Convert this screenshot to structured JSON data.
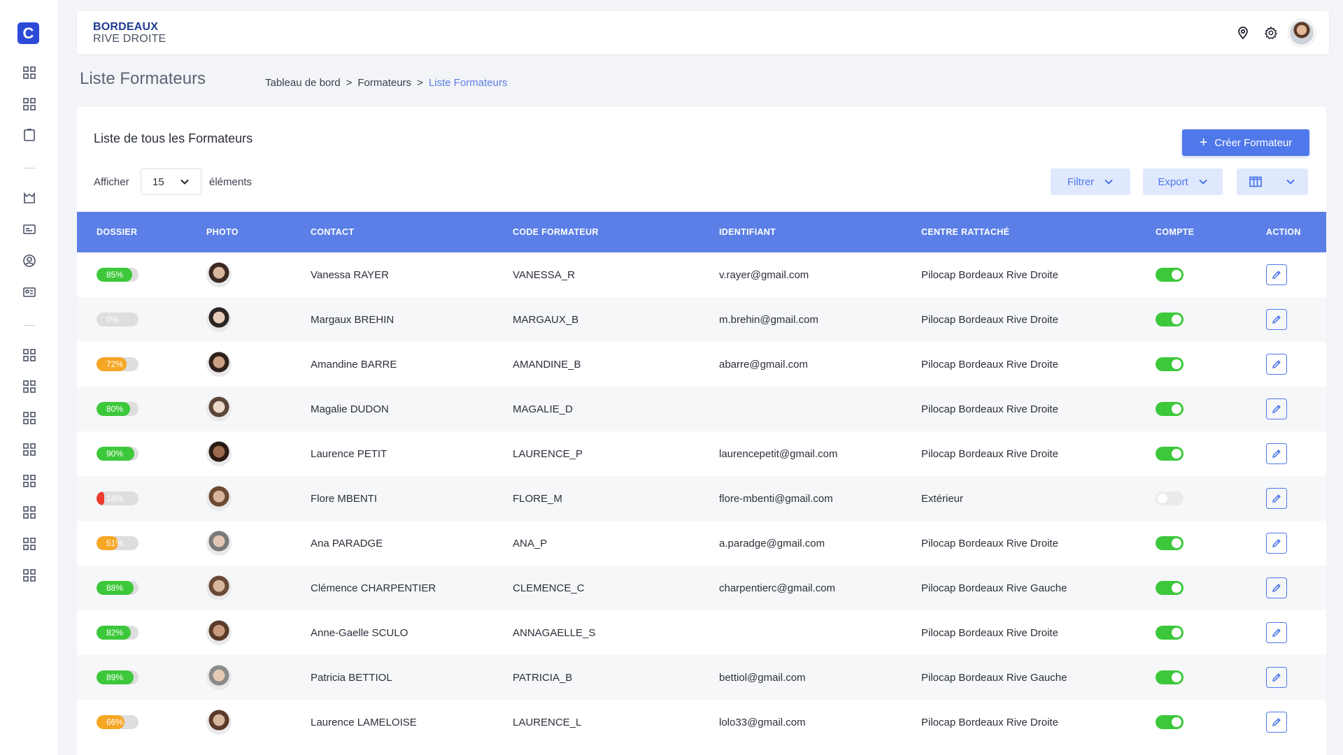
{
  "app": {
    "logo_letter": "C",
    "accent": "#4f78ea",
    "header_blue": "#5b7fe6"
  },
  "topbar": {
    "brand_line1": "BORDEAUX",
    "brand_line2": "RIVE DROITE",
    "icons": [
      "location-pin-icon",
      "gear-icon",
      "user-avatar"
    ]
  },
  "sidebar": {
    "icons": [
      "grid-icon",
      "grid-icon",
      "clipboard-icon",
      "inbox-icon",
      "id-card-icon",
      "user-circle-icon",
      "contact-card-icon",
      "grid-icon",
      "grid-icon",
      "grid-icon",
      "grid-icon",
      "grid-icon",
      "grid-icon",
      "grid-icon",
      "grid-icon"
    ]
  },
  "page": {
    "title": "Liste Formateurs",
    "breadcrumb": [
      "Tableau de bord",
      "Formateurs",
      "Liste Formateurs"
    ],
    "breadcrumb_sep": ">"
  },
  "card": {
    "title": "Liste de tous les Formateurs",
    "create_label": "Créer Formateur",
    "show_label": "Afficher",
    "page_size": "15",
    "elements_label": "éléments",
    "filter_label": "Filtrer",
    "export_label": "Export"
  },
  "table": {
    "headers": [
      "DOSSIER",
      "PHOTO",
      "CONTACT",
      "CODE FORMATEUR",
      "IDENTIFIANT",
      "CENTRE RATTACHÉ",
      "COMPTE",
      "ACTION"
    ],
    "rows": [
      {
        "dossier": "85%",
        "pct": 0.85,
        "color": "#3cc83a",
        "contact": "Vanessa RAYER",
        "code": "VANESSA_R",
        "identifiant": "v.rayer@gmail.com",
        "centre": "Pilocap Bordeaux Rive Droite",
        "compte": true
      },
      {
        "dossier": "0%",
        "pct": 0.0,
        "color": "#3cc83a",
        "contact": "Margaux BREHIN",
        "code": "MARGAUX_B",
        "identifiant": "m.brehin@gmail.com",
        "centre": "Pilocap Bordeaux Rive Droite",
        "compte": true
      },
      {
        "dossier": "72%",
        "pct": 0.72,
        "color": "#f5a623",
        "contact": "Amandine BARRE",
        "code": "AMANDINE_B",
        "identifiant": "abarre@gmail.com",
        "centre": "Pilocap Bordeaux Rive Droite",
        "compte": true
      },
      {
        "dossier": "80%",
        "pct": 0.8,
        "color": "#3cc83a",
        "contact": "Magalie DUDON",
        "code": "MAGALIE_D",
        "identifiant": "",
        "centre": "Pilocap Bordeaux Rive Droite",
        "compte": true
      },
      {
        "dossier": "90%",
        "pct": 0.9,
        "color": "#3cc83a",
        "contact": "Laurence PETIT",
        "code": "LAURENCE_P",
        "identifiant": "laurencepetit@gmail.com",
        "centre": "Pilocap Bordeaux Rive Droite",
        "compte": true
      },
      {
        "dossier": "18%",
        "pct": 0.18,
        "color": "#ee3b2c",
        "contact": "Flore MBENTI",
        "code": "FLORE_M",
        "identifiant": "flore-mbenti@gmail.com",
        "centre": "Extérieur",
        "compte": false
      },
      {
        "dossier": "51%",
        "pct": 0.51,
        "color": "#f5a623",
        "contact": "Ana PARADGE",
        "code": "ANA_P",
        "identifiant": "a.paradge@gmail.com",
        "centre": "Pilocap Bordeaux Rive Droite",
        "compte": true
      },
      {
        "dossier": "88%",
        "pct": 0.88,
        "color": "#3cc83a",
        "contact": "Clémence CHARPENTIER",
        "code": "CLEMENCE_C",
        "identifiant": "charpentierc@gmail.com",
        "centre": "Pilocap Bordeaux Rive Gauche",
        "compte": true
      },
      {
        "dossier": "82%",
        "pct": 0.82,
        "color": "#3cc83a",
        "contact": "Anne-Gaelle SCULO",
        "code": "ANNAGAELLE_S",
        "identifiant": "",
        "centre": "Pilocap Bordeaux Rive Droite",
        "compte": true
      },
      {
        "dossier": "89%",
        "pct": 0.89,
        "color": "#3cc83a",
        "contact": "Patricia BETTIOL",
        "code": "PATRICIA_B",
        "identifiant": "bettiol@gmail.com",
        "centre": "Pilocap Bordeaux Rive Gauche",
        "compte": true
      },
      {
        "dossier": "66%",
        "pct": 0.66,
        "color": "#f5a623",
        "contact": "Laurence LAMELOISE",
        "code": "LAURENCE_L",
        "identifiant": "lolo33@gmail.com",
        "centre": "Pilocap Bordeaux Rive Droite",
        "compte": true
      }
    ]
  }
}
